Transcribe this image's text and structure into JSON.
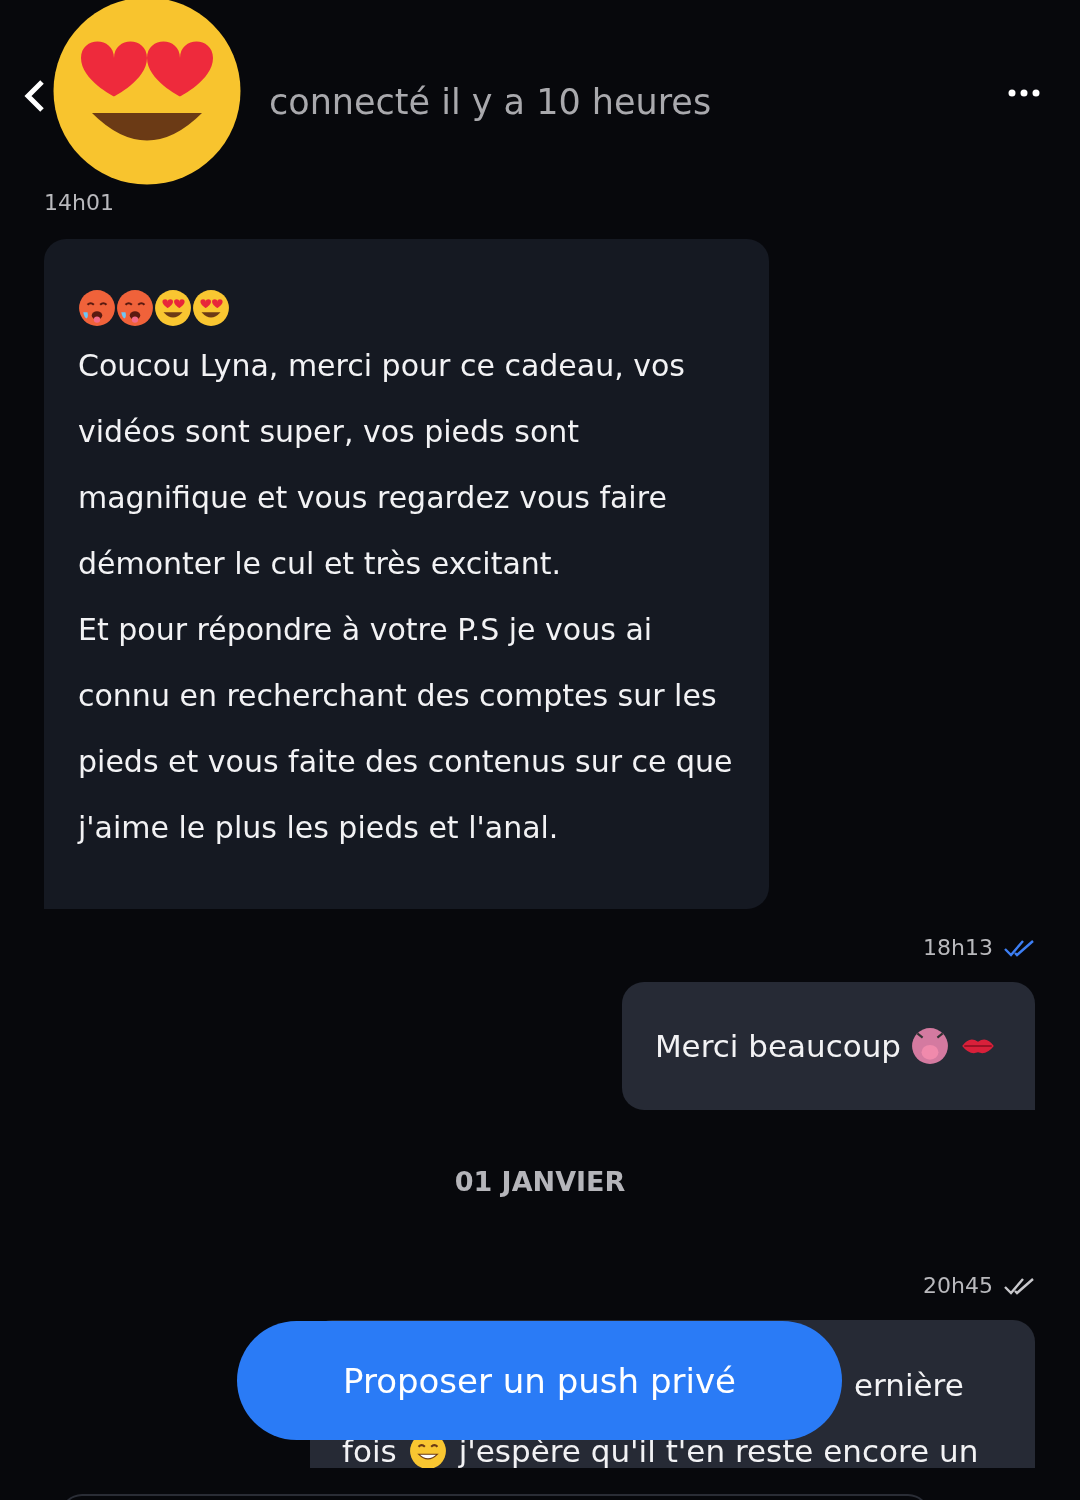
{
  "header": {
    "status": "connecté il y a 10 heures"
  },
  "messages": [
    {
      "kind": "incoming",
      "time": "14h01",
      "paragraphs": [
        "Coucou Lyna, merci pour ce cadeau, vos vidéos sont super, vos pieds sont magnifique et vous regardez vous faire démonter le cul et très excitant.",
        "Et pour répondre à votre P.S je vous ai connu en recherchant des comptes sur les pieds et vous faite des contenus sur ce que j'aime le plus les pieds et l'anal."
      ]
    },
    {
      "kind": "outgoing",
      "time": "18h13",
      "read": true,
      "text": "Merci beaucoup"
    },
    {
      "kind": "date",
      "text": "01 JANVIER"
    },
    {
      "kind": "outgoing-cut",
      "time": "20h45",
      "read": false,
      "lines": [
        "ernière",
        "fois",
        "j'espère qu'il t'en reste encore un"
      ]
    }
  ],
  "push_button": {
    "label": "Proposer un push privé"
  }
}
